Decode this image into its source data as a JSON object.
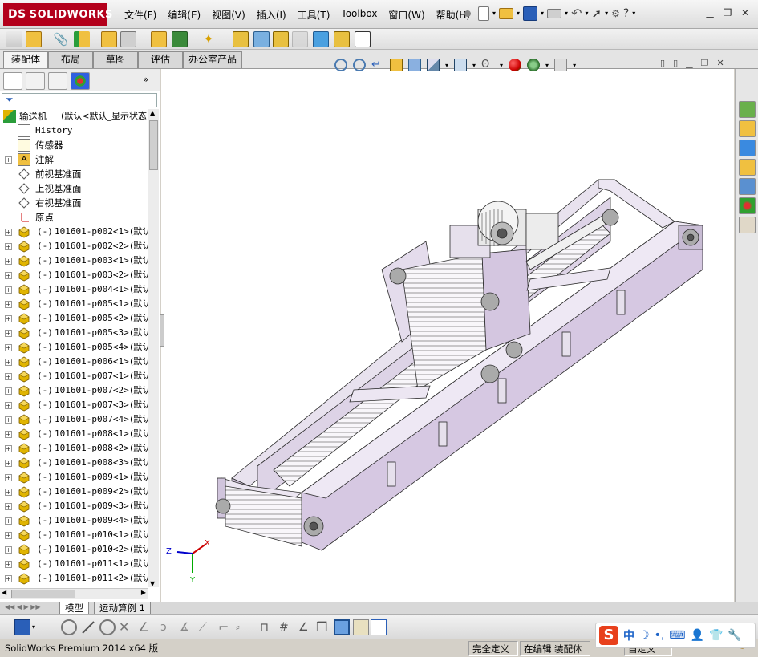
{
  "app": {
    "logo_text": "SOLIDWORKS",
    "logo_mark": "DS"
  },
  "menu": [
    {
      "label": "文件(F)"
    },
    {
      "label": "编辑(E)"
    },
    {
      "label": "视图(V)"
    },
    {
      "label": "插入(I)"
    },
    {
      "label": "工具(T)"
    },
    {
      "label": "Toolbox"
    },
    {
      "label": "窗口(W)"
    },
    {
      "label": "帮助(H)"
    }
  ],
  "command_tabs": [
    {
      "label": "装配体",
      "active": true
    },
    {
      "label": "布局"
    },
    {
      "label": "草图"
    },
    {
      "label": "评估"
    },
    {
      "label": "办公室产品"
    }
  ],
  "tree": {
    "root": {
      "label": "输送机",
      "config": "(默认<默认_显示状态"
    },
    "items": [
      {
        "label": "History",
        "icon": "history-icon",
        "mono": true,
        "expand": false
      },
      {
        "label": "传感器",
        "icon": "sensor-icon",
        "expand": false
      },
      {
        "label": "注解",
        "icon": "annotation-icon",
        "expand": true
      },
      {
        "label": "前视基准面",
        "icon": "plane-icon",
        "expand": false
      },
      {
        "label": "上视基准面",
        "icon": "plane-icon",
        "expand": false
      },
      {
        "label": "右视基准面",
        "icon": "plane-icon",
        "expand": false
      },
      {
        "label": "原点",
        "icon": "origin-icon",
        "expand": false
      }
    ],
    "parts": [
      {
        "prefix": "(-)",
        "name": "101601-p002<1>",
        "config": "(默认"
      },
      {
        "prefix": "(-)",
        "name": "101601-p002<2>",
        "config": "(默认"
      },
      {
        "prefix": "(-)",
        "name": "101601-p003<1>",
        "config": "(默认"
      },
      {
        "prefix": "(-)",
        "name": "101601-p003<2>",
        "config": "(默认"
      },
      {
        "prefix": "(-)",
        "name": "101601-p004<1>",
        "config": "(默认"
      },
      {
        "prefix": "(-)",
        "name": "101601-p005<1>",
        "config": "(默认"
      },
      {
        "prefix": "(-)",
        "name": "101601-p005<2>",
        "config": "(默认"
      },
      {
        "prefix": "(-)",
        "name": "101601-p005<3>",
        "config": "(默认"
      },
      {
        "prefix": "(-)",
        "name": "101601-p005<4>",
        "config": "(默认"
      },
      {
        "prefix": "(-)",
        "name": "101601-p006<1>",
        "config": "(默认"
      },
      {
        "prefix": "(-)",
        "name": "101601-p007<1>",
        "config": "(默认"
      },
      {
        "prefix": "(-)",
        "name": "101601-p007<2>",
        "config": "(默认"
      },
      {
        "prefix": "(-)",
        "name": "101601-p007<3>",
        "config": "(默认"
      },
      {
        "prefix": "(-)",
        "name": "101601-p007<4>",
        "config": "(默认"
      },
      {
        "prefix": "(-)",
        "name": "101601-p008<1>",
        "config": "(默认"
      },
      {
        "prefix": "(-)",
        "name": "101601-p008<2>",
        "config": "(默认"
      },
      {
        "prefix": "(-)",
        "name": "101601-p008<3>",
        "config": "(默认"
      },
      {
        "prefix": "(-)",
        "name": "101601-p009<1>",
        "config": "(默认"
      },
      {
        "prefix": "(-)",
        "name": "101601-p009<2>",
        "config": "(默认"
      },
      {
        "prefix": "(-)",
        "name": "101601-p009<3>",
        "config": "(默认"
      },
      {
        "prefix": "(-)",
        "name": "101601-p009<4>",
        "config": "(默认"
      },
      {
        "prefix": "(-)",
        "name": "101601-p010<1>",
        "config": "(默认"
      },
      {
        "prefix": "(-)",
        "name": "101601-p010<2>",
        "config": "(默认"
      },
      {
        "prefix": "(-)",
        "name": "101601-p011<1>",
        "config": "(默认"
      },
      {
        "prefix": "(-)",
        "name": "101601-p011<2>",
        "config": "(默认"
      }
    ]
  },
  "bottom_tabs": [
    {
      "label": "模型",
      "active": true
    },
    {
      "label": "运动算例 1"
    }
  ],
  "triad": {
    "x_label": "X",
    "y_label": "Y",
    "z_label": "Z"
  },
  "status": {
    "product": "SolidWorks Premium 2014 x64 版",
    "definition": "完全定义",
    "editing": "在编辑 装配体",
    "custom": "自定义"
  },
  "ime": {
    "mode_label": "中"
  },
  "colors": {
    "accent": "#b3001b",
    "model_body": "#d9cde3",
    "model_edge": "#2a2a2a",
    "part_icon": "#e0b400"
  }
}
